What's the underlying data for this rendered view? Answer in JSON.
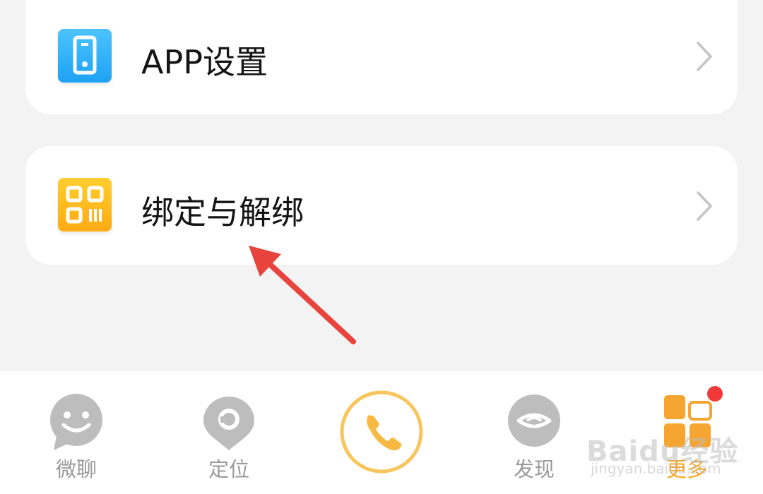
{
  "settings": {
    "items": [
      {
        "label": "APP设置",
        "icon": "phone-settings-icon"
      },
      {
        "label": "绑定与解绑",
        "icon": "qr-code-icon"
      }
    ]
  },
  "tabbar": {
    "tabs": [
      {
        "label": "微聊",
        "icon": "smile-chat-icon",
        "active": false
      },
      {
        "label": "定位",
        "icon": "location-pin-icon",
        "active": false
      },
      {
        "label": "",
        "icon": "phone-call-icon",
        "active": false
      },
      {
        "label": "发现",
        "icon": "discover-eye-icon",
        "active": false
      },
      {
        "label": "更多",
        "icon": "more-grid-icon",
        "active": true
      }
    ],
    "notification_dot": true
  },
  "watermark": {
    "text": "Baidu经验",
    "url_text": "jingyan.baidu.com"
  },
  "colors": {
    "accent": "#f5a623",
    "blue_icon": "#1ea2f3",
    "yellow_icon": "#ffaa12",
    "inactive": "#9a9a9a",
    "badge": "#f03a3a",
    "arrow": "#e8433c"
  }
}
